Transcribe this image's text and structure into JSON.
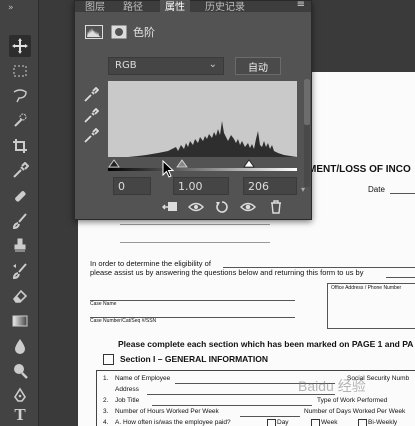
{
  "panel": {
    "tabs": [
      "图层",
      "路径",
      "属性",
      "历史记录"
    ],
    "active_tab": "属性",
    "menu_icon": "menu-icon",
    "header_label": "色阶",
    "channel": "RGB",
    "auto_button": "自动",
    "input_black": "0",
    "input_gray": "1.00",
    "input_white": "206",
    "footer_icons": [
      "clip-to-layer-icon",
      "view-previous-icon",
      "reset-icon",
      "visibility-icon",
      "delete-icon"
    ]
  },
  "tools": [
    "move-icon",
    "marquee-icon",
    "lasso-icon",
    "quick-select-icon",
    "crop-icon",
    "eyedropper-icon",
    "healing-brush-icon",
    "brush-icon",
    "clone-stamp-icon",
    "history-brush-icon",
    "eraser-icon",
    "gradient-icon",
    "blur-icon",
    "dodge-icon",
    "pen-icon",
    "type-icon"
  ],
  "document": {
    "title": "MENT/LOSS OF INCO",
    "date_label": "Date",
    "intro1": "In order to determine the eligibility of",
    "intro2": "please assist us by answering the questions below and returning this form to us by",
    "case_name": "Case Name",
    "case_number": "Case Number/Cat/Seq #/SSN",
    "office_address": "Office Address / Phone Number",
    "instruction": "Please complete each section which has been marked on PAGE 1 and PA",
    "section1": "Section I – GENERAL INFORMATION",
    "items": [
      {
        "n": "1.",
        "label": "Name of Employee",
        "right": "Social Security Numb"
      },
      {
        "n": "",
        "label": "Address",
        "right": ""
      },
      {
        "n": "2.",
        "label": "Job Title",
        "right": "Type of Work Performed"
      },
      {
        "n": "3.",
        "label": "Number of Hours Worked Per Week",
        "right": "Number of Days Worked Per Week"
      },
      {
        "n": "4.",
        "label": "A.  How often is/was the employee paid?",
        "right": ""
      }
    ],
    "pay_options": [
      "Day",
      "Week",
      "Bi-Weekly"
    ]
  },
  "watermark": "Baidu 经验",
  "colors": {
    "panel": "#535353",
    "toolbar": "#434343",
    "histogram_bg": "#cfcfcf",
    "histogram": "#2a2a2a"
  }
}
